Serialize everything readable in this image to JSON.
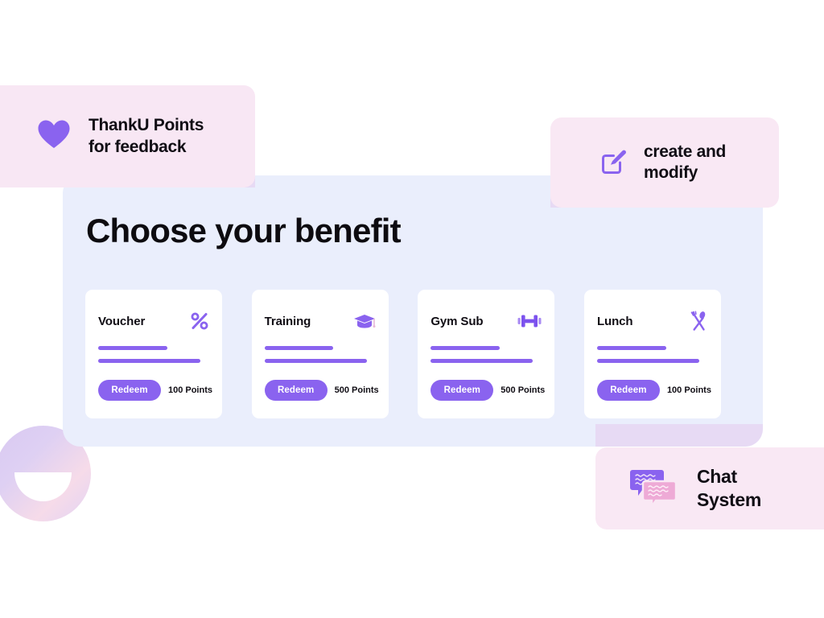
{
  "badges": {
    "thanku": {
      "icon": "heart-icon",
      "label": "ThankU Points\nfor feedback"
    },
    "create": {
      "icon": "edit-square-icon",
      "label": "create and\nmodify"
    },
    "chat": {
      "icon": "chat-bubbles-icon",
      "label": "Chat\nSystem"
    }
  },
  "panel": {
    "title": "Choose your benefit",
    "cards": [
      {
        "title": "Voucher",
        "icon": "percent-icon",
        "button_label": "Redeem",
        "points": "100 Points"
      },
      {
        "title": "Training",
        "icon": "graduation-cap-icon",
        "button_label": "Redeem",
        "points": "500 Points"
      },
      {
        "title": "Gym  Sub",
        "icon": "dumbbell-icon",
        "button_label": "Redeem",
        "points": "500 Points"
      },
      {
        "title": "Lunch",
        "icon": "fork-spoon-icon",
        "button_label": "Redeem",
        "points": "100 Points"
      }
    ]
  },
  "decoration": {
    "circle": "smiley-circle-decoration"
  },
  "colors": {
    "accent_purple": "#8a63ef",
    "panel_background": "#eaeefc",
    "badge_pink": "#f9e8f4",
    "card_white": "#ffffff",
    "text_dark": "#100d14",
    "chat_bubble_pink": "#eeaad6"
  }
}
